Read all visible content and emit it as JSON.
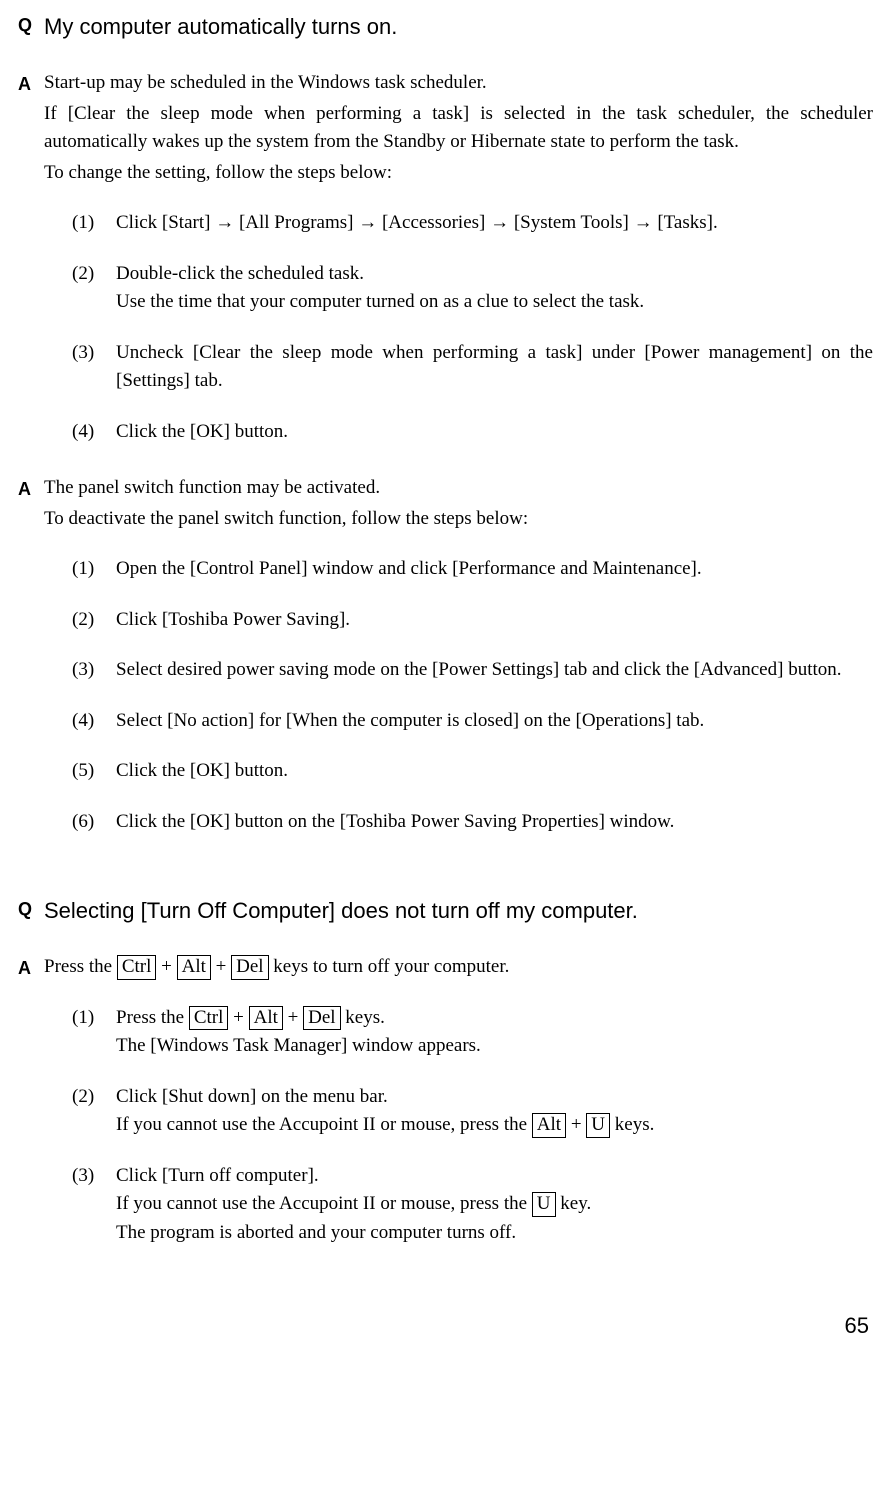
{
  "q1": {
    "prefix": "Q",
    "text": "My computer automatically turns on."
  },
  "a1": {
    "prefix": "A",
    "p1": "Start-up may be scheduled in the Windows task scheduler.",
    "p2": "If [Clear the sleep mode when performing a task] is selected in the task scheduler, the scheduler automatically wakes up the system from the Standby or Hibernate state to perform the task.",
    "p3": "To change the setting, follow the steps below:",
    "steps": [
      {
        "n": "(1)",
        "t": "Click [Start] → [All Programs] → [Accessories] → [System Tools] → [Tasks]."
      },
      {
        "n": "(2)",
        "t": "Double-click the scheduled task.",
        "t2": "Use the time that your computer turned on as a clue to select the task."
      },
      {
        "n": "(3)",
        "t": "Uncheck [Clear the sleep mode when performing a task] under [Power management] on the [Settings] tab."
      },
      {
        "n": "(4)",
        "t": "Click the [OK] button."
      }
    ]
  },
  "a2": {
    "prefix": "A",
    "p1": "The panel switch function may be activated.",
    "p2": "To deactivate the panel switch function, follow the steps below:",
    "steps": [
      {
        "n": "(1)",
        "t": "Open the [Control Panel] window and click [Performance and Maintenance]."
      },
      {
        "n": "(2)",
        "t": "Click [Toshiba Power Saving]."
      },
      {
        "n": "(3)",
        "t": "Select desired power saving mode on the [Power Settings] tab and click the [Advanced] button."
      },
      {
        "n": "(4)",
        "t": "Select [No action] for [When the computer is closed] on the [Operations] tab."
      },
      {
        "n": "(5)",
        "t": "Click the [OK] button."
      },
      {
        "n": "(6)",
        "t": "Click the [OK] button on the [Toshiba Power Saving Properties] window."
      }
    ]
  },
  "q2": {
    "prefix": "Q",
    "text": "Selecting [Turn Off Computer] does not turn off my computer."
  },
  "a3": {
    "prefix": "A",
    "intro_pre": "Press the ",
    "intro_key1": "Ctrl",
    "intro_plus": " + ",
    "intro_key2": "Alt",
    "intro_key3": "Del",
    "intro_post": " keys to turn off your computer.",
    "s1_n": "(1)",
    "s1_pre": "Press the ",
    "s1_k1": "Ctrl",
    "s1_k2": "Alt",
    "s1_k3": "Del",
    "s1_post": " keys.",
    "s1_l2": "The [Windows Task Manager] window appears.",
    "s2_n": "(2)",
    "s2_l1": "Click [Shut down] on the menu bar.",
    "s2_l2_pre": "If you cannot use the Accupoint II or mouse, press the ",
    "s2_k1": "Alt",
    "s2_k2": "U",
    "s2_l2_post": " keys.",
    "s3_n": "(3)",
    "s3_l1": "Click [Turn off computer].",
    "s3_l2_pre": "If you cannot use the Accupoint II or mouse, press the ",
    "s3_k1": "U",
    "s3_l2_post": " key.",
    "s3_l3": "The program is aborted and your computer turns off."
  },
  "page": "65"
}
